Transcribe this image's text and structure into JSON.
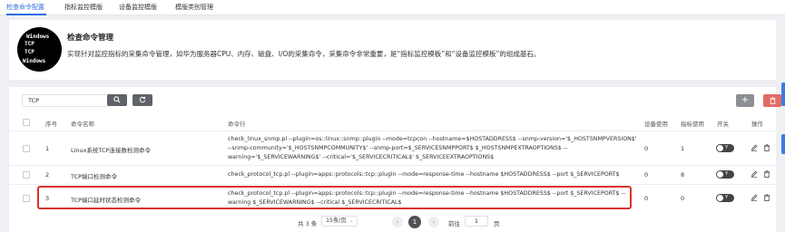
{
  "tabs": [
    {
      "label": "检查命令配置",
      "active": true
    },
    {
      "label": "指标监控模版",
      "active": false
    },
    {
      "label": "设备监控模版",
      "active": false
    },
    {
      "label": "模版类别管理",
      "active": false
    }
  ],
  "header": {
    "logo_lines": [
      "Windows",
      "TCP",
      "TCP",
      "Windows"
    ],
    "title": "检查命令管理",
    "description": "实现针对监控指标的采集命令管理，如华为服务器CPU、内存、磁盘、I/O的采集命令，采集命令非常重要，是“指标监控模板”和“设备监控模板”的组成基石。"
  },
  "toolbar": {
    "search_value": "TCP",
    "search_icon": "search-icon",
    "refresh_icon": "refresh-icon",
    "add_label": "+",
    "delete_icon": "trash-icon"
  },
  "table": {
    "columns": {
      "index": "序号",
      "name": "命令名称",
      "cmdline": "命令行",
      "device_use": "设备使用",
      "metric_use": "指标使用",
      "switch": "开关",
      "ops": "操作"
    },
    "rows": [
      {
        "index": "1",
        "name": "Linux系统TCP连接数检测命令",
        "cmd_lines": [
          "check_linux_snmp.pl --plugin=os::linux::snmp::plugin --mode=tcpcon --hostname=$HOSTADDRESS$ --snmp-version='$_HOSTSNMPVERSION$'",
          "--snmp-community='$_HOSTSNMPCOMMUNITY$' --snmp-port=$_SERVICESNMPPORT$ $_HOSTSNMPEXTRAOPTIONS$ --",
          "warning='$_SERVICEWARNING$' --critical='$_SERVICECRITICAL$' $_SERVICEEXTRAOPTIONS$"
        ],
        "device_use": "0",
        "metric_use": "1",
        "switch_label": "Y"
      },
      {
        "index": "2",
        "name": "TCP端口检测命令",
        "cmd_lines": [
          "check_protocol_tcp.pl --plugin=apps::protocols::tcp::plugin --mode=response-time --hostname $HOSTADDRESS$ --port $_SERVICEPORT$"
        ],
        "device_use": "0",
        "metric_use": "8",
        "switch_label": "Y"
      },
      {
        "index": "3",
        "name": "TCP端口延时状态检测命令",
        "cmd_lines": [
          "check_protocol_tcp.pl --plugin=apps::protocols::tcp::plugin --mode=response-time --hostname $HOSTADDRESS$ --port $_SERVICEPORT$ --",
          "warning $_SERVICEWARNING$ --critical $_SERVICECRITICAL$"
        ],
        "device_use": "0",
        "metric_use": "0",
        "switch_label": "Y"
      }
    ]
  },
  "pagination": {
    "total_text": "共 3 条",
    "page_size": "15条/页",
    "prev": "‹",
    "current": "1",
    "next": "›",
    "goto_label": "前往",
    "goto_value": "1",
    "page_suffix": "页"
  },
  "colors": {
    "accent": "#2e6fe0",
    "danger": "#e36b64",
    "highlight_border": "#d9342b",
    "dark_button": "#5f6369"
  }
}
